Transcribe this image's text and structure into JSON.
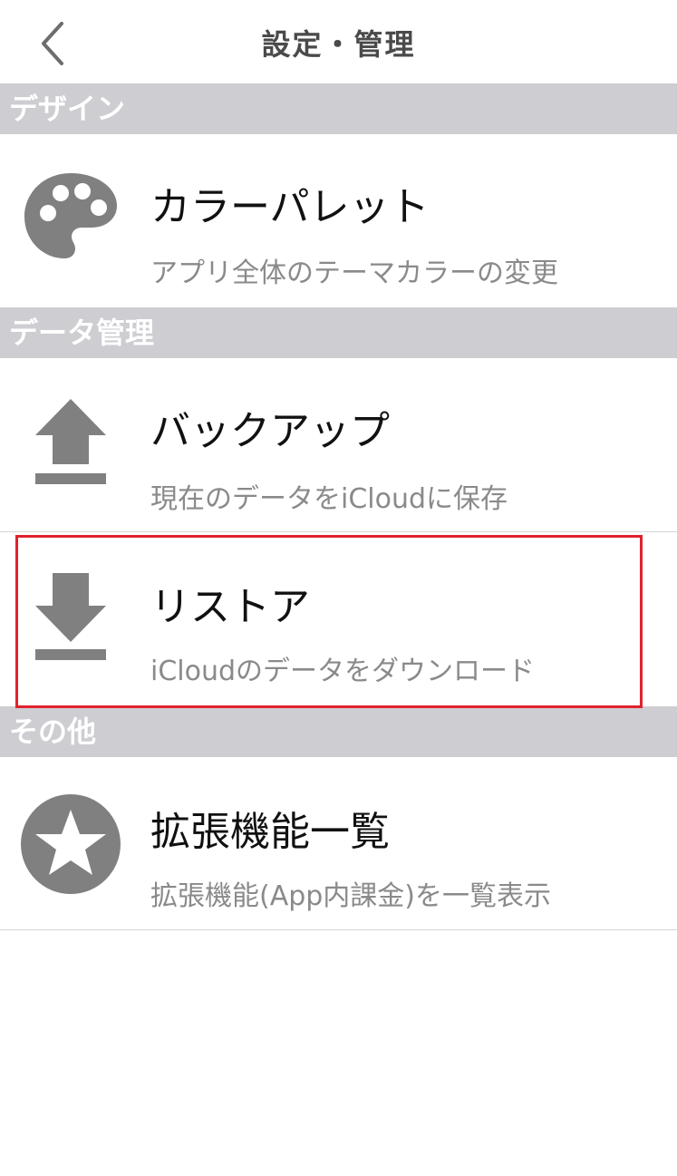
{
  "nav": {
    "title": "設定・管理",
    "back_icon": "chevron-left-icon"
  },
  "sections": [
    {
      "header": "デザイン"
    },
    {
      "header": "データ管理"
    },
    {
      "header": "その他"
    }
  ],
  "rows": {
    "color_palette": {
      "title": "カラーパレット",
      "subtitle": "アプリ全体のテーマカラーの変更",
      "icon": "palette-icon"
    },
    "backup": {
      "title": "バックアップ",
      "subtitle": "現在のデータをiCloudに保存",
      "icon": "upload-icon"
    },
    "restore": {
      "title": "リストア",
      "subtitle": "iCloudのデータをダウンロード",
      "icon": "download-icon"
    },
    "extensions": {
      "title": "拡張機能一覧",
      "subtitle": "拡張機能(App内課金)を一覧表示",
      "icon": "star-icon"
    }
  },
  "colors": {
    "section_header_bg": "#cdcdd2",
    "icon_gray": "#808080",
    "highlight_border": "#e0222c"
  }
}
